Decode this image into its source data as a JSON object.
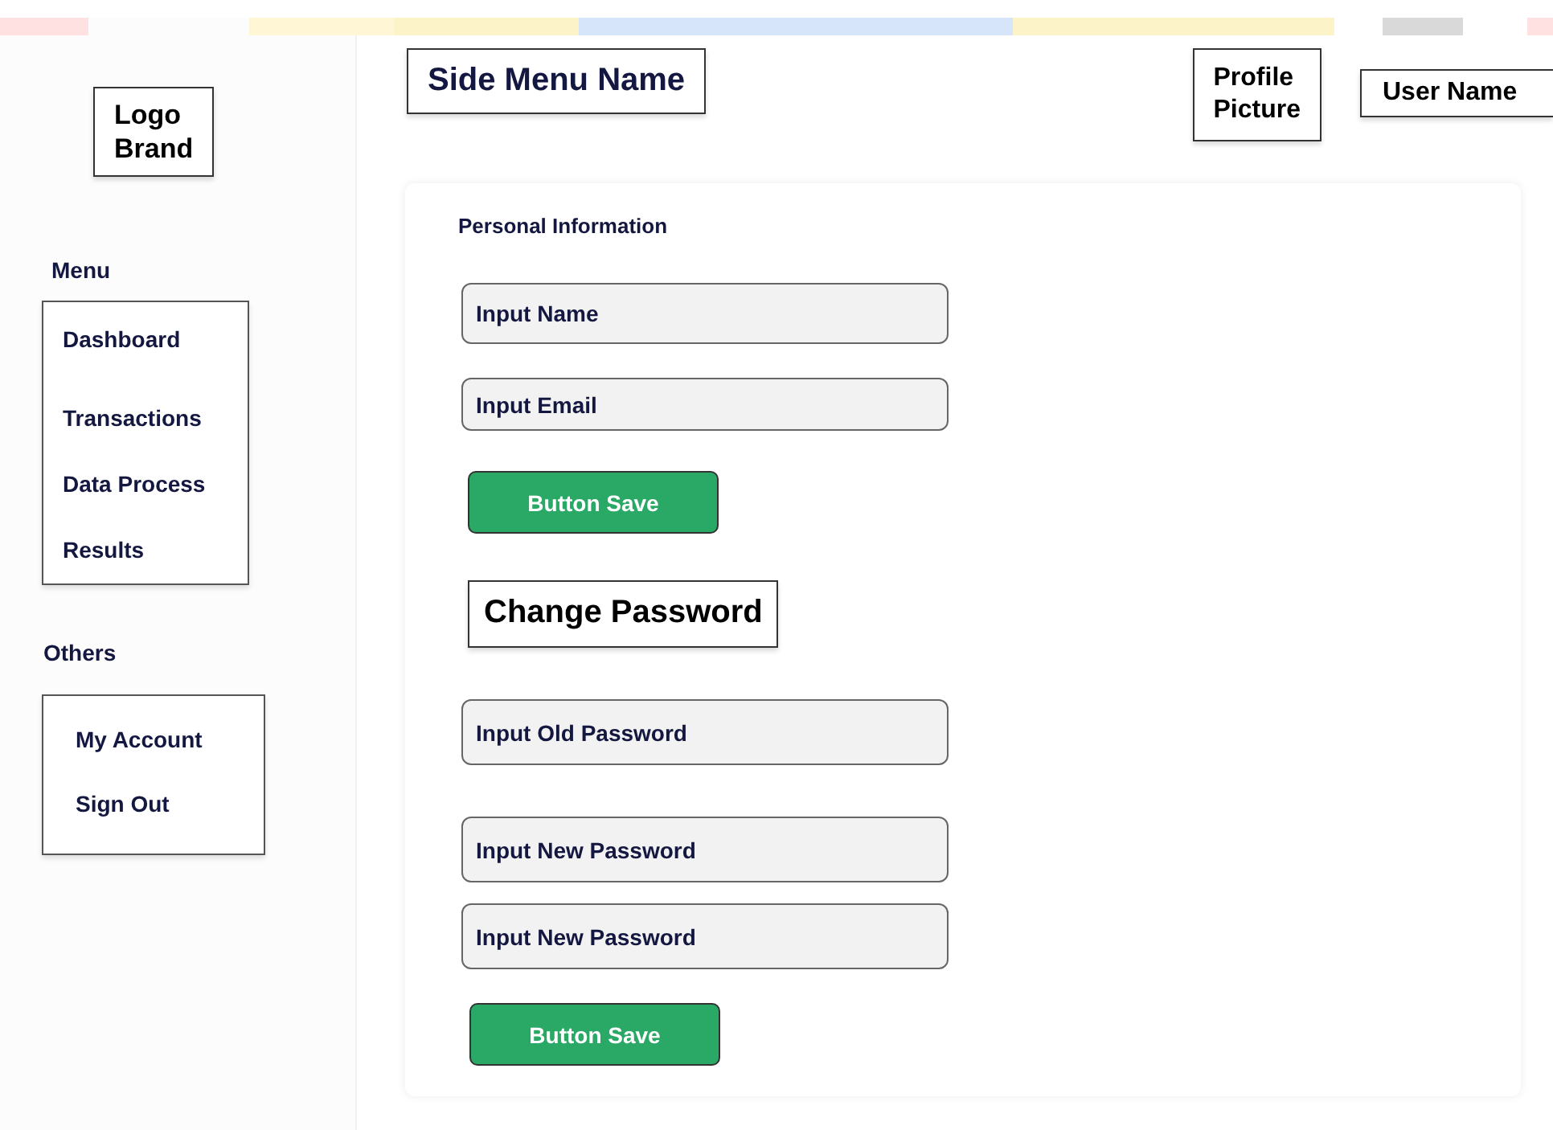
{
  "sidebar": {
    "logo": "Logo Brand",
    "menu_title": "Menu",
    "menu_items": [
      "Dashboard",
      "Transactions",
      "Data Process",
      "Results"
    ],
    "others_title": "Others",
    "others_items": [
      "My Account",
      "Sign Out"
    ]
  },
  "header": {
    "title": "Side Menu Name",
    "profile_picture": "Profile Picture",
    "user_name": "User Name"
  },
  "personal_information": {
    "title": "Personal Information",
    "fields": [
      {
        "placeholder": "Input Name"
      },
      {
        "placeholder": "Input Email"
      }
    ],
    "button": "Button Save"
  },
  "change_password": {
    "title": "Change Password",
    "fields": [
      {
        "placeholder": "Input Old Password"
      },
      {
        "placeholder": "Input New Password"
      },
      {
        "placeholder": "Input New Password"
      }
    ],
    "button": "Button Save"
  }
}
